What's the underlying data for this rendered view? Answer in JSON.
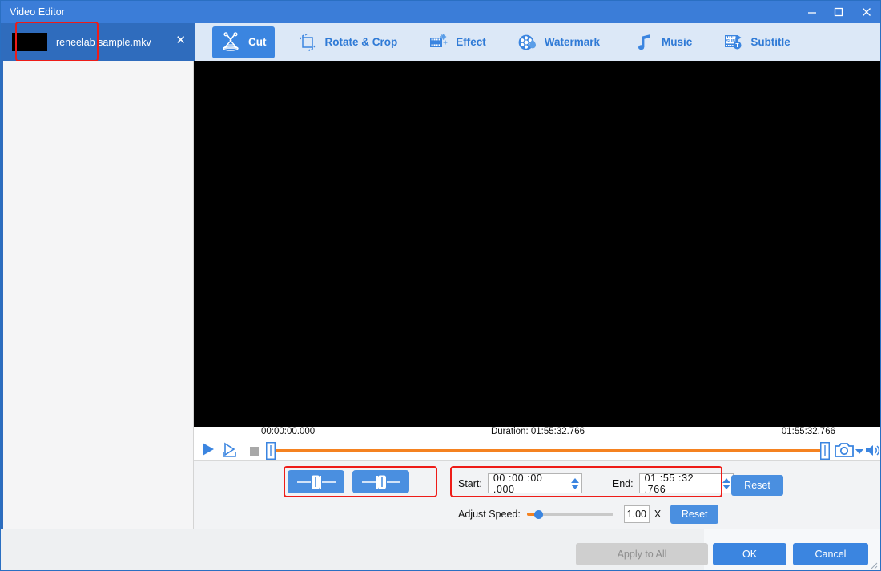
{
  "window": {
    "title": "Video Editor",
    "minimize_icon": "minimize-icon",
    "maximize_icon": "maximize-icon",
    "close_icon": "close-icon"
  },
  "file_tab": {
    "name": "reneelab sample.mkv",
    "close_label": "✕",
    "thumbnail": "video-thumbnail"
  },
  "toolbar": {
    "tabs": [
      {
        "label": "Cut",
        "icon": "scissors-icon",
        "active": true
      },
      {
        "label": "Rotate & Crop",
        "icon": "rotate-crop-icon",
        "active": false
      },
      {
        "label": "Effect",
        "icon": "film-sparkle-icon",
        "active": false
      },
      {
        "label": "Watermark",
        "icon": "film-reel-droplet-icon",
        "active": false
      },
      {
        "label": "Music",
        "icon": "music-note-icon",
        "active": false
      },
      {
        "label": "Subtitle",
        "icon": "subtitle-film-icon",
        "active": false
      }
    ]
  },
  "timeline": {
    "start_time": "00:00:00.000",
    "duration_label": "Duration: 01:55:32.766",
    "end_time": "01:55:32.766",
    "play_icon": "play-icon",
    "step_icon": "play-frame-icon",
    "stop_icon": "stop-icon",
    "snapshot_icon": "camera-icon",
    "snapshot_caret_icon": "chevron-down-icon",
    "volume_icon": "volume-icon",
    "left_handle_icon": "trim-start-handle",
    "right_handle_icon": "trim-end-handle"
  },
  "trim": {
    "set_start_icon": "set-start-marker-icon",
    "set_end_icon": "set-end-marker-icon",
    "start_label": "Start:",
    "start_value": "00 :00 :00 .000",
    "end_label": "End:",
    "end_value": "01 :55 :32 .766",
    "reset_label": "Reset"
  },
  "speed": {
    "label": "Adjust Speed:",
    "value": "1.00",
    "unit": "X",
    "reset_label": "Reset"
  },
  "footer": {
    "apply_label": "Apply to All",
    "ok_label": "OK",
    "cancel_label": "Cancel"
  },
  "colors": {
    "title_bar": "#3b7dd8",
    "accent_blue": "#3b85e0",
    "tab_strip": "#dce8f7",
    "active_tab": "#2f6cbd",
    "track_orange": "#f58220",
    "highlight_red": "#ee1c18",
    "disabled_gray": "#cfcfcf"
  }
}
